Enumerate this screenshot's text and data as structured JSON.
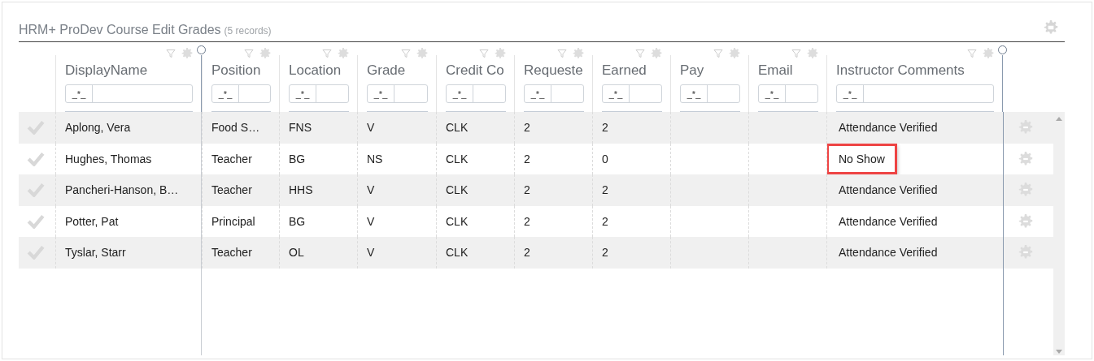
{
  "title": "HRM+ ProDev Course Edit Grades",
  "record_count": "(5 records)",
  "columns": [
    {
      "label": "DisplayName",
      "filter_operator": "_*_"
    },
    {
      "label": "Position",
      "filter_operator": "_*_"
    },
    {
      "label": "Location",
      "filter_operator": "_*_"
    },
    {
      "label": "Grade",
      "filter_operator": "_*_"
    },
    {
      "label": "Credit Co",
      "filter_operator": "_*_"
    },
    {
      "label": "Requeste",
      "filter_operator": "_*_"
    },
    {
      "label": "Earned",
      "filter_operator": "_*_"
    },
    {
      "label": "Pay",
      "filter_operator": "_*_"
    },
    {
      "label": "Email",
      "filter_operator": "_*_"
    },
    {
      "label": "Instructor Comments",
      "filter_operator": "_*_"
    }
  ],
  "rows": [
    {
      "name": "Aplong, Vera",
      "position": "Food S…",
      "location": "FNS",
      "grade": "V",
      "credit_code": "CLK",
      "requested": "2",
      "earned": "2",
      "comment": "Attendance Verified",
      "highlighted": false
    },
    {
      "name": "Hughes, Thomas",
      "position": "Teacher",
      "location": "BG",
      "grade": "NS",
      "credit_code": "CLK",
      "requested": "2",
      "earned": "0",
      "comment": "No Show",
      "highlighted": true
    },
    {
      "name": "Pancheri-Hanson, B…",
      "position": "Teacher",
      "location": "HHS",
      "grade": "V",
      "credit_code": "CLK",
      "requested": "2",
      "earned": "2",
      "comment": "Attendance Verified",
      "highlighted": false
    },
    {
      "name": "Potter, Pat",
      "position": "Principal",
      "location": "BG",
      "grade": "V",
      "credit_code": "CLK",
      "requested": "2",
      "earned": "2",
      "comment": "Attendance Verified",
      "highlighted": false
    },
    {
      "name": "Tyslar, Starr",
      "position": "Teacher",
      "location": "OL",
      "grade": "V",
      "credit_code": "CLK",
      "requested": "2",
      "earned": "2",
      "comment": "Attendance Verified",
      "highlighted": false
    }
  ]
}
